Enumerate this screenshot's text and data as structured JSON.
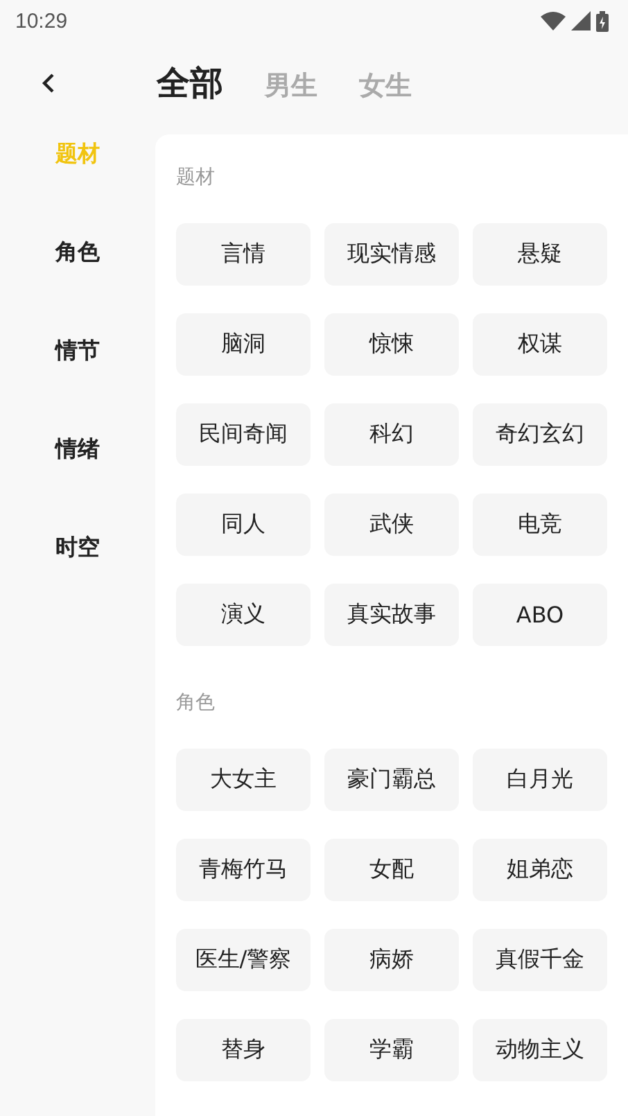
{
  "status_bar": {
    "time": "10:29"
  },
  "tabs": [
    {
      "label": "全部",
      "selected": true
    },
    {
      "label": "男生",
      "selected": false
    },
    {
      "label": "女生",
      "selected": false
    }
  ],
  "sidebar": {
    "items": [
      {
        "label": "题材",
        "selected": true
      },
      {
        "label": "角色",
        "selected": false
      },
      {
        "label": "情节",
        "selected": false
      },
      {
        "label": "情绪",
        "selected": false
      },
      {
        "label": "时空",
        "selected": false
      }
    ]
  },
  "sections": [
    {
      "title": "题材",
      "tags": [
        "言情",
        "现实情感",
        "悬疑",
        "脑洞",
        "惊悚",
        "权谋",
        "民间奇闻",
        "科幻",
        "奇幻玄幻",
        "同人",
        "武侠",
        "电竞",
        "演义",
        "真实故事",
        "ABO"
      ]
    },
    {
      "title": "角色",
      "tags": [
        "大女主",
        "豪门霸总",
        "白月光",
        "青梅竹马",
        "女配",
        "姐弟恋",
        "医生/警察",
        "病娇",
        "真假千金",
        "替身",
        "学霸",
        "动物主义"
      ]
    }
  ]
}
